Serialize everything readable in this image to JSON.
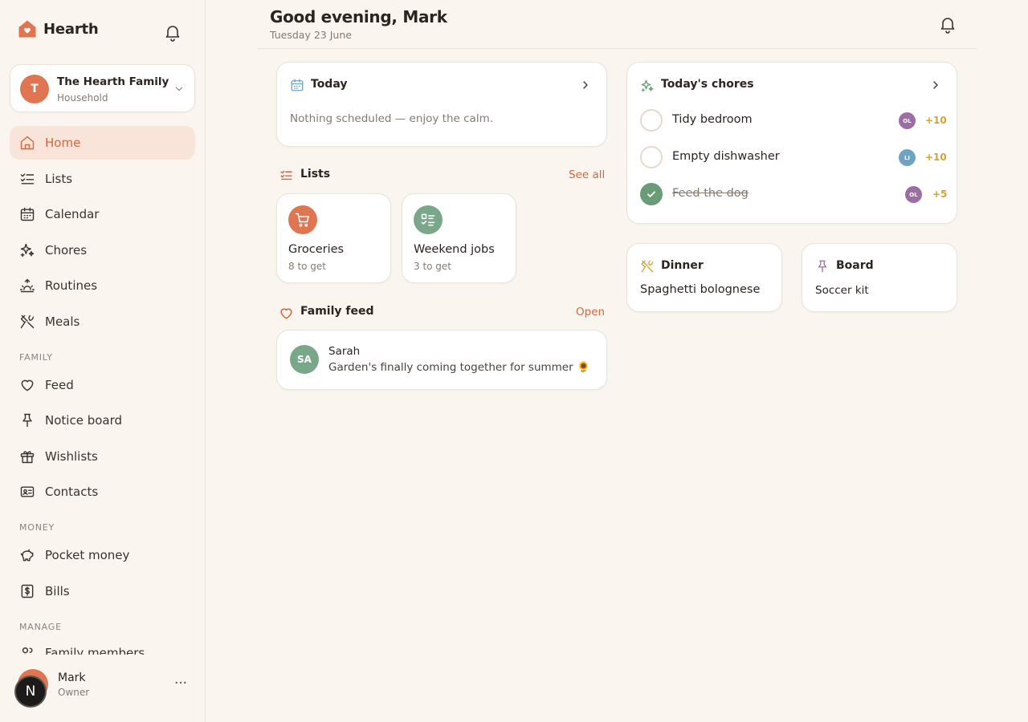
{
  "app": {
    "name": "Hearth"
  },
  "household": {
    "initial": "T",
    "name": "The Hearth Family",
    "role": "Household"
  },
  "nav": {
    "main": [
      {
        "label": "Home",
        "icon": "home-icon",
        "active": true
      },
      {
        "label": "Lists",
        "icon": "list-checks-icon"
      },
      {
        "label": "Calendar",
        "icon": "calendar-icon"
      },
      {
        "label": "Chores",
        "icon": "sparkles-icon"
      },
      {
        "label": "Routines",
        "icon": "sunrise-icon"
      },
      {
        "label": "Meals",
        "icon": "utensils-icon"
      }
    ],
    "family_label": "FAMILY",
    "family": [
      {
        "label": "Feed",
        "icon": "heart-icon"
      },
      {
        "label": "Notice board",
        "icon": "pin-icon"
      },
      {
        "label": "Wishlists",
        "icon": "gift-icon"
      },
      {
        "label": "Contacts",
        "icon": "contact-card-icon"
      }
    ],
    "money_label": "MONEY",
    "money": [
      {
        "label": "Pocket money",
        "icon": "piggy-bank-icon"
      },
      {
        "label": "Bills",
        "icon": "dollar-receipt-icon"
      }
    ],
    "manage_label": "MANAGE",
    "manage": [
      {
        "label": "Family members",
        "icon": "users-icon"
      }
    ]
  },
  "user": {
    "badge": "N",
    "name": "Mark",
    "role": "Owner"
  },
  "header": {
    "greeting": "Good evening, Mark",
    "date": "Tuesday 23 June"
  },
  "today": {
    "title": "Today",
    "empty": "Nothing scheduled — enjoy the calm."
  },
  "lists": {
    "title": "Lists",
    "see_all": "See all",
    "items": [
      {
        "name": "Groceries",
        "count": "8 to get",
        "color": "#e07551",
        "icon": "cart-icon"
      },
      {
        "name": "Weekend jobs",
        "count": "3 to get",
        "color": "#7aa78a",
        "icon": "checklist-icon"
      }
    ]
  },
  "feed": {
    "title": "Family feed",
    "open": "Open",
    "post": {
      "initials": "SA",
      "author": "Sarah",
      "text": "Garden's finally coming together for summer 🌻"
    }
  },
  "chores": {
    "title": "Today's chores",
    "items": [
      {
        "name": "Tidy bedroom",
        "assignee": "OL",
        "assignee_color": "#9b6fa3",
        "points": "+10",
        "done": false
      },
      {
        "name": "Empty dishwasher",
        "assignee": "LI",
        "assignee_color": "#6fa3c4",
        "points": "+10",
        "done": false
      },
      {
        "name": "Feed the dog",
        "assignee": "OL",
        "assignee_color": "#9b6fa3",
        "points": "+5",
        "done": true
      }
    ]
  },
  "dinner": {
    "title": "Dinner",
    "value": "Spaghetti bolognese"
  },
  "board": {
    "title": "Board",
    "value": "Soccer kit"
  }
}
